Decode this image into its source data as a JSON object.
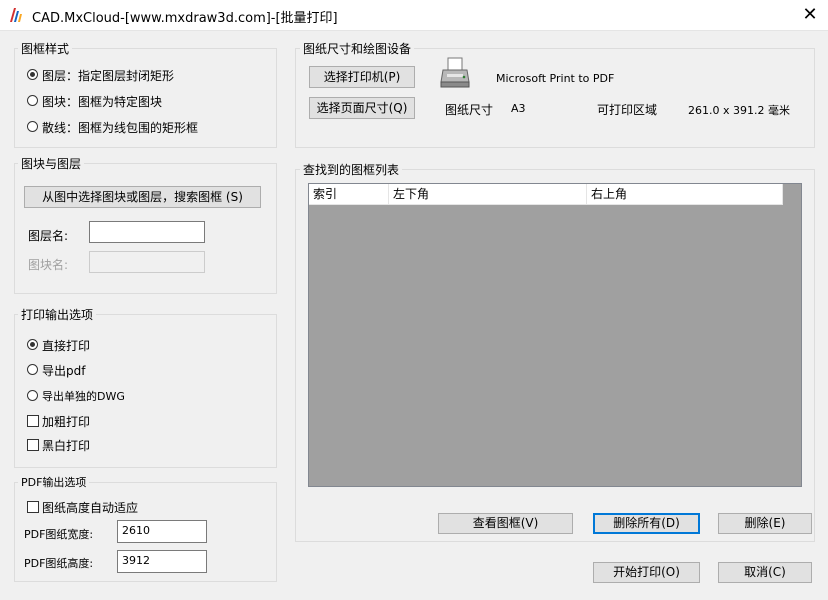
{
  "window": {
    "title": "CAD.MxCloud-[www.mxdraw3d.com]-[批量打印]",
    "close_glyph": "✕"
  },
  "frame_style": {
    "title": "图框样式",
    "options": [
      {
        "label": "图层：指定图层封闭矩形",
        "selected": true
      },
      {
        "label": "图块：图框为特定图块",
        "selected": false
      },
      {
        "label": "散线：图框为线包围的矩形框",
        "selected": false
      }
    ]
  },
  "block_layer": {
    "title": "图块与图层",
    "select_button": "从图中选择图块或图层，搜索图框 (S)",
    "layer_label": "图层名:",
    "layer_value": "",
    "block_label": "图块名:",
    "block_value": ""
  },
  "print_output": {
    "title": "打印输出选项",
    "radios": [
      {
        "label": "直接打印",
        "selected": true
      },
      {
        "label": "导出pdf",
        "selected": false
      },
      {
        "label": "导出单独的DWG",
        "selected": false
      }
    ],
    "checks": [
      {
        "label": "加粗打印",
        "checked": false
      },
      {
        "label": "黑白打印",
        "checked": false
      }
    ]
  },
  "pdf_output": {
    "title": "PDF输出选项",
    "auto_fit_label": "图纸高度自动适应",
    "auto_fit_checked": false,
    "width_label": "PDF图纸宽度:",
    "width_value": "2610",
    "height_label": "PDF图纸高度:",
    "height_value": "3912"
  },
  "paper": {
    "title": "图纸尺寸和绘图设备",
    "select_printer_button": "选择打印机(P)",
    "select_page_button": "选择页面尺寸(Q)",
    "printer_name": "Microsoft Print to PDF",
    "printer_icon": "printer-icon",
    "paper_size_label": "图纸尺寸",
    "paper_size_value": "A3",
    "printable_label": "可打印区域",
    "printable_value": "261.0 x 391.2 毫米"
  },
  "frame_list": {
    "title": "查找到的图框列表",
    "columns": [
      "索引",
      "左下角",
      "右上角"
    ],
    "rows": []
  },
  "list_buttons": {
    "view": "查看图框(V)",
    "delete_all": "删除所有(D)",
    "delete": "删除(E)"
  },
  "footer": {
    "start": "开始打印(O)",
    "cancel": "取消(C)"
  },
  "colors": {
    "window_bg": "#f0f0f0",
    "list_bg": "#a0a0a0",
    "focus": "#0078d7"
  }
}
